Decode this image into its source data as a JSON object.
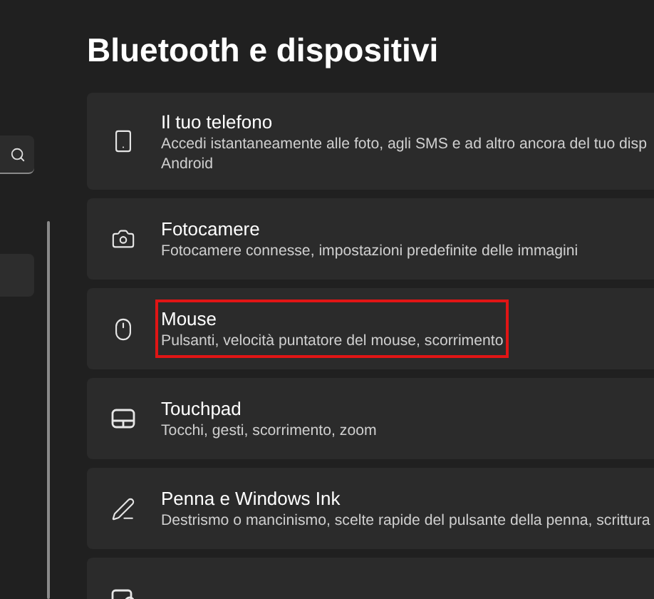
{
  "page": {
    "title": "Bluetooth e dispositivi"
  },
  "sidebar": {
    "items": [
      {
        "selected": true
      }
    ]
  },
  "items": [
    {
      "kind": "phone",
      "title": "Il tuo telefono",
      "description_lines": [
        "Accedi istantaneamente alle foto, agli SMS e ad altro ancora del tuo disp",
        "Android"
      ],
      "highlighted": false
    },
    {
      "kind": "camera",
      "title": "Fotocamere",
      "description_lines": [
        "Fotocamere connesse, impostazioni predefinite delle immagini"
      ],
      "highlighted": false
    },
    {
      "kind": "mouse",
      "title": "Mouse",
      "description_lines": [
        "Pulsanti, velocità puntatore del mouse, scorrimento"
      ],
      "highlighted": true
    },
    {
      "kind": "touchpad",
      "title": "Touchpad",
      "description_lines": [
        "Tocchi, gesti, scorrimento, zoom"
      ],
      "highlighted": false
    },
    {
      "kind": "pen",
      "title": "Penna e Windows Ink",
      "description_lines": [
        "Destrismo o mancinismo, scelte rapide del pulsante della penna, scrittura"
      ],
      "highlighted": false
    },
    {
      "kind": "autoplay",
      "highlighted": false
    }
  ]
}
